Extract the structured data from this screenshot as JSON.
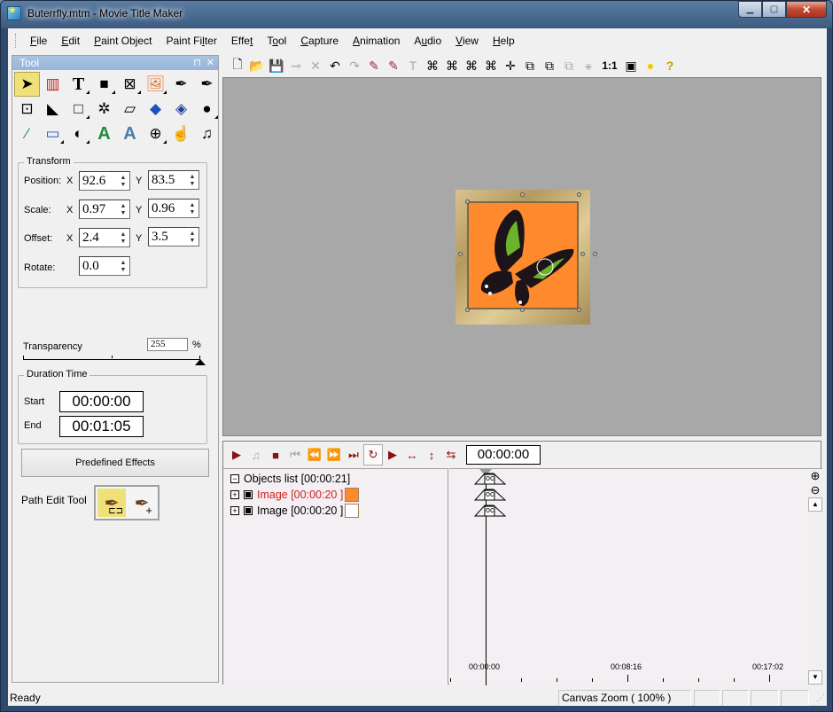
{
  "window": {
    "title": "Buterrfly.mtm - Movie Title Maker",
    "controls": [
      "minimize",
      "maximize",
      "close"
    ]
  },
  "menubar": [
    {
      "label": "File",
      "u": "F"
    },
    {
      "label": "Edit",
      "u": "E"
    },
    {
      "label": "Paint Object",
      "u": "P"
    },
    {
      "label": "Paint Filter",
      "u": "l"
    },
    {
      "label": "Effet",
      "u": "t"
    },
    {
      "label": "Tool",
      "u": "o"
    },
    {
      "label": "Capture",
      "u": "C"
    },
    {
      "label": "Animation",
      "u": "A"
    },
    {
      "label": "Audio",
      "u": "u"
    },
    {
      "label": "View",
      "u": "V"
    },
    {
      "label": "Help",
      "u": "H"
    }
  ],
  "tool_panel": {
    "title": "Tool",
    "pin": "⊓",
    "close": "✕",
    "tools": [
      {
        "name": "select-arrow",
        "glyph": "➤",
        "selected": true
      },
      {
        "name": "color-bars",
        "glyph": "▥"
      },
      {
        "name": "text",
        "glyph": "T",
        "menu": true
      },
      {
        "name": "rectangle-filled",
        "glyph": "■",
        "menu": true
      },
      {
        "name": "crop-transform",
        "glyph": "⊠",
        "menu": true
      },
      {
        "name": "image",
        "glyph": "🖼",
        "menu": true
      },
      {
        "name": "pen-add",
        "glyph": "✒",
        "menu": false
      },
      {
        "name": "pen",
        "glyph": "✒"
      },
      {
        "name": "play-region",
        "glyph": "⊡"
      },
      {
        "name": "arrow-fill",
        "glyph": "◣"
      },
      {
        "name": "rectangle-outline",
        "glyph": "□",
        "menu": true
      },
      {
        "name": "magic-wand",
        "glyph": "✲"
      },
      {
        "name": "eraser",
        "glyph": "▱"
      },
      {
        "name": "paint-bucket",
        "glyph": "◆"
      },
      {
        "name": "fill-pattern",
        "glyph": "◈"
      },
      {
        "name": "blur-drop",
        "glyph": "●",
        "menu": true
      },
      {
        "name": "eyedropper",
        "glyph": "⁄"
      },
      {
        "name": "window-frame",
        "glyph": "▭",
        "menu": true
      },
      {
        "name": "smudge",
        "glyph": "◐",
        "menu": true
      },
      {
        "name": "text-glow",
        "glyph": "A"
      },
      {
        "name": "text-sparkle",
        "glyph": "A"
      },
      {
        "name": "zoom",
        "glyph": "⊕",
        "menu": true
      },
      {
        "name": "hand",
        "glyph": "☝"
      },
      {
        "name": "music",
        "glyph": "♫"
      }
    ],
    "transform": {
      "title": "Transform",
      "position": {
        "label": "Position:",
        "x": "92.6",
        "y": "83.5"
      },
      "scale": {
        "label": "Scale:",
        "x": "0.97",
        "y": "0.96"
      },
      "offset": {
        "label": "Offset:",
        "x": "2.4",
        "y": "3.5"
      },
      "rotate": {
        "label": "Rotate:",
        "value": "0.0"
      },
      "x_label": "X",
      "y_label": "Y"
    },
    "transparency": {
      "label": "Transparency",
      "value": "255",
      "unit": "%",
      "level": 1.0
    },
    "duration": {
      "title": "Duration Time",
      "start_label": "Start",
      "start": "00:00:00",
      "end_label": "End",
      "end": "00:01:05"
    },
    "predefined_effects": "Predefined Effects",
    "path_edit_tool": "Path Edit Tool"
  },
  "toolbar": [
    {
      "name": "new",
      "glyph": "🗋"
    },
    {
      "name": "open",
      "glyph": "📂"
    },
    {
      "name": "save",
      "glyph": "💾"
    },
    {
      "name": "add-node",
      "glyph": "⊸",
      "disabled": true
    },
    {
      "name": "delete",
      "glyph": "✕",
      "disabled": true
    },
    {
      "name": "undo",
      "glyph": "↶"
    },
    {
      "name": "redo",
      "glyph": "↷",
      "disabled": true
    },
    {
      "name": "pen-add",
      "glyph": "✎"
    },
    {
      "name": "pen-select",
      "glyph": "✎"
    },
    {
      "name": "text",
      "glyph": "T",
      "disabled": true
    },
    {
      "name": "align-1",
      "glyph": "⌘"
    },
    {
      "name": "align-2",
      "glyph": "⌘"
    },
    {
      "name": "align-3",
      "glyph": "⌘"
    },
    {
      "name": "align-4",
      "glyph": "⌘"
    },
    {
      "name": "center",
      "glyph": "✛"
    },
    {
      "name": "bring-front",
      "glyph": "⧉"
    },
    {
      "name": "send-back",
      "glyph": "⧉"
    },
    {
      "name": "group",
      "glyph": "⧉",
      "disabled": true
    },
    {
      "name": "wand",
      "glyph": "⚹",
      "disabled": true
    },
    {
      "name": "actual-size",
      "glyph": "1:1"
    },
    {
      "name": "preview",
      "glyph": "▣"
    },
    {
      "name": "record",
      "glyph": "●"
    },
    {
      "name": "help",
      "glyph": "?"
    }
  ],
  "timeline": {
    "controls": [
      {
        "name": "play",
        "glyph": "▶"
      },
      {
        "name": "audio",
        "glyph": "♫",
        "disabled": true
      },
      {
        "name": "stop",
        "glyph": "■"
      },
      {
        "name": "first",
        "glyph": "⏮",
        "disabled": true
      },
      {
        "name": "rewind",
        "glyph": "⏪",
        "disabled": true
      },
      {
        "name": "forward",
        "glyph": "⏩"
      },
      {
        "name": "last",
        "glyph": "⏭"
      },
      {
        "name": "loop",
        "glyph": "↻",
        "selected": true
      },
      {
        "name": "play-mark",
        "glyph": "▶"
      },
      {
        "name": "stretch-horizontal",
        "glyph": "↔"
      },
      {
        "name": "stretch-vertical",
        "glyph": "↕"
      },
      {
        "name": "repeat",
        "glyph": "⇆"
      }
    ],
    "current_time": "00:00:00",
    "objects_list": "Objects list [00:00:21]",
    "objects": [
      {
        "label": "Image [00:00:20 ]",
        "active": true
      },
      {
        "label": "Image [00:00:20 ]",
        "active": false
      }
    ],
    "ruler": [
      "00:00:00",
      "00:08:16",
      "00:17:02"
    ],
    "keyframe_label": "oc"
  },
  "statusbar": {
    "text": "Ready",
    "zoom": "Canvas Zoom ( 100% )"
  },
  "colors": {
    "canvas_bg": "#a8a8a8",
    "picture_bg": "#ff8a2e",
    "active_object": "#d02020",
    "accent_selected": "#f0e07a",
    "titlebar": "#3e5c82"
  }
}
